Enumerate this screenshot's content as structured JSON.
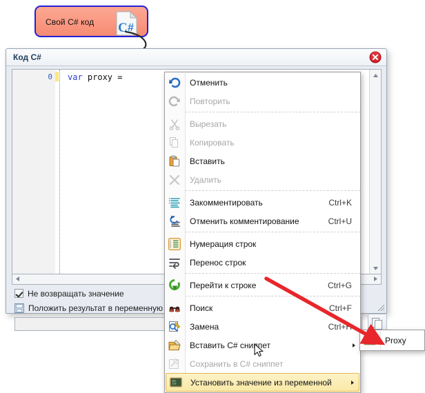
{
  "diagram": {
    "node_label": "Свой C# код",
    "node_icon": "csharp-file-icon",
    "node_border_color": "#2020d8",
    "node_fill_top": "#fba893",
    "node_fill_bottom": "#f58a72"
  },
  "window": {
    "title": "Код C#",
    "close_icon": "close-icon"
  },
  "editor": {
    "line_number": "0",
    "code_keyword": "var",
    "code_rest": " proxy = "
  },
  "options": {
    "no_return_label": "Не возвращать значение",
    "no_return_checked": true,
    "put_result_label": "Положить результат в переменную",
    "put_result_checked": false,
    "variable_value": "",
    "variable_placeholder": ""
  },
  "context_menu": {
    "items": [
      {
        "label": "Отменить",
        "accel": "",
        "icon": "undo-icon",
        "disabled": false,
        "submenu": false,
        "sep_after": false
      },
      {
        "label": "Повторить",
        "accel": "",
        "icon": "redo-icon",
        "disabled": true,
        "submenu": false,
        "sep_after": true
      },
      {
        "label": "Вырезать",
        "accel": "",
        "icon": "cut-icon",
        "disabled": true,
        "submenu": false,
        "sep_after": false
      },
      {
        "label": "Копировать",
        "accel": "",
        "icon": "copy-icon",
        "disabled": true,
        "submenu": false,
        "sep_after": false
      },
      {
        "label": "Вставить",
        "accel": "",
        "icon": "paste-icon",
        "disabled": false,
        "submenu": false,
        "sep_after": false
      },
      {
        "label": "Удалить",
        "accel": "",
        "icon": "delete-icon",
        "disabled": true,
        "submenu": false,
        "sep_after": true
      },
      {
        "label": "Закомментировать",
        "accel": "Ctrl+K",
        "icon": "comment-lines-icon",
        "disabled": false,
        "submenu": false,
        "sep_after": false
      },
      {
        "label": "Отменить комментирование",
        "accel": "Ctrl+U",
        "icon": "uncomment-lines-icon",
        "disabled": false,
        "submenu": false,
        "sep_after": true
      },
      {
        "label": "Нумерация строк",
        "accel": "",
        "icon": "line-numbers-icon",
        "disabled": false,
        "submenu": false,
        "sep_after": false
      },
      {
        "label": "Перенос строк",
        "accel": "",
        "icon": "word-wrap-icon",
        "disabled": false,
        "submenu": false,
        "sep_after": true
      },
      {
        "label": "Перейти к строке",
        "accel": "Ctrl+G",
        "icon": "goto-line-icon",
        "disabled": false,
        "submenu": false,
        "sep_after": true
      },
      {
        "label": "Поиск",
        "accel": "Ctrl+F",
        "icon": "find-icon",
        "disabled": false,
        "submenu": false,
        "sep_after": false
      },
      {
        "label": "Замена",
        "accel": "Ctrl+H",
        "icon": "replace-icon",
        "disabled": false,
        "submenu": false,
        "sep_after": false
      },
      {
        "label": "Вставить C# сниппет",
        "accel": "",
        "icon": "insert-snippet-icon",
        "disabled": false,
        "submenu": true,
        "sep_after": false
      },
      {
        "label": "Сохранить в C# сниппет",
        "accel": "",
        "icon": "save-snippet-icon",
        "disabled": true,
        "submenu": false,
        "sep_after": false
      },
      {
        "label": "Установить значение из переменной",
        "accel": "",
        "icon": "set-value-from-variable-icon",
        "disabled": false,
        "submenu": true,
        "sep_after": false,
        "highlighted": true
      }
    ],
    "highlight_bg_top": "#fdf2c8",
    "highlight_bg_bottom": "#fae9a6",
    "highlight_border": "#e8b64b"
  },
  "submenu": {
    "items": [
      {
        "label": "Proxy",
        "icon": "variable-icon"
      }
    ]
  },
  "annotation": {
    "arrow_color": "#e8262b",
    "cursor_icon": "mouse-pointer-icon"
  },
  "toolbar": {
    "variable_dropdown_icon": "chevron-down-icon",
    "copy_button_icon": "copy-pages-icon",
    "resize_grip_icon": "resize-grip-icon"
  }
}
